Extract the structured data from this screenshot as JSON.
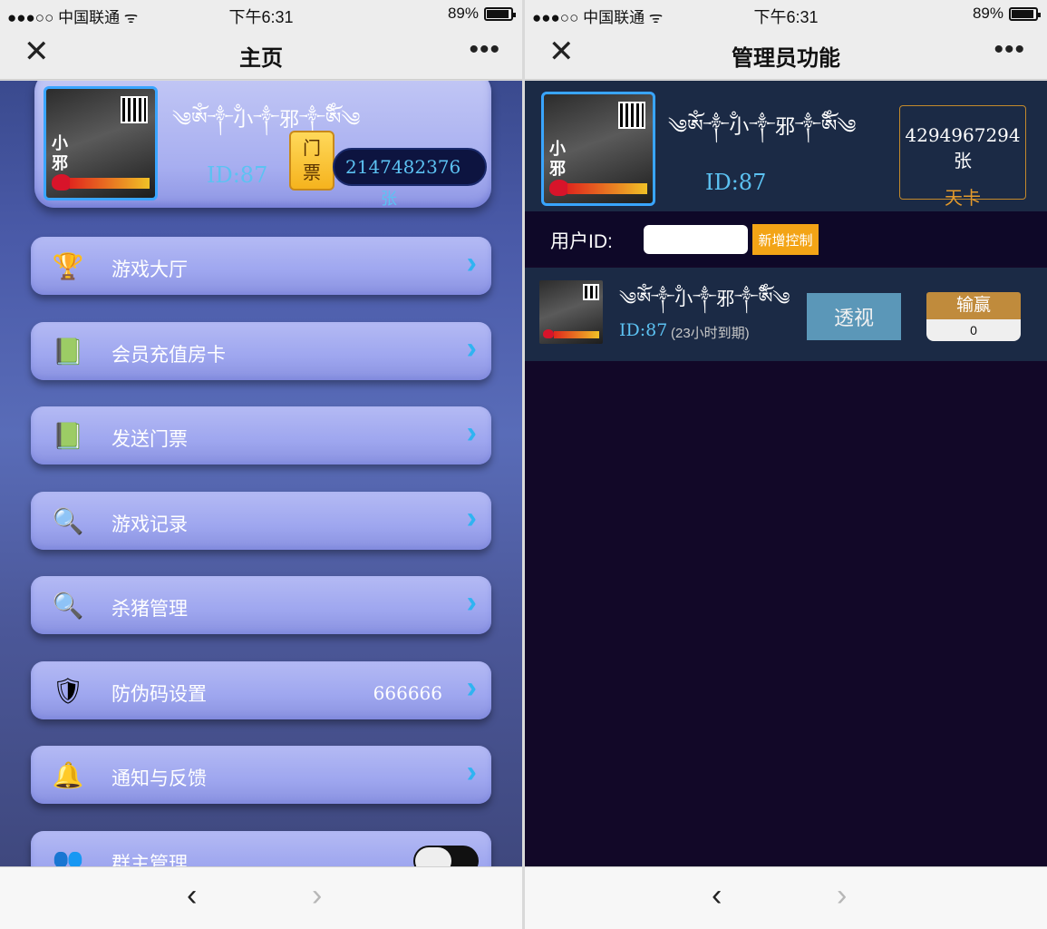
{
  "status_bar": {
    "carrier": "●●●○○ 中国联通 ᯤ",
    "time": "下午6:31",
    "battery": "89%"
  },
  "left_screen": {
    "nav": {
      "close_icon": "✕",
      "title": "主页",
      "more_icon": "•••"
    },
    "profile": {
      "avatar_text": "小\n邪",
      "nickname": "༄ༀ༒ྃ小༒邪༒ྃༀ༄",
      "id": "ID:87",
      "ticket_badge": "门\n票",
      "ticket_count": "2147482376",
      "ticket_unit": "张"
    },
    "menu": [
      {
        "icon": "trophy-icon",
        "glyph": "🏆",
        "label": "游戏大厅",
        "value": "",
        "control": "arrow"
      },
      {
        "icon": "book-icon",
        "glyph": "📗",
        "label": "会员充值房卡",
        "value": "",
        "control": "arrow"
      },
      {
        "icon": "book-icon",
        "glyph": "📗",
        "label": "发送门票",
        "value": "",
        "control": "arrow"
      },
      {
        "icon": "magnifier-icon",
        "glyph": "🔍",
        "label": "游戏记录",
        "value": "",
        "control": "arrow"
      },
      {
        "icon": "magnifier-icon",
        "glyph": "🔍",
        "label": "杀猪管理",
        "value": "",
        "control": "arrow"
      },
      {
        "icon": "shield-icon",
        "glyph": "🛡",
        "label": "防伪码设置",
        "value": "666666",
        "control": "arrow"
      },
      {
        "icon": "bell-icon",
        "glyph": "🔔",
        "label": "通知与反馈",
        "value": "",
        "control": "arrow"
      },
      {
        "icon": "group-icon",
        "glyph": "👥",
        "label": "群主管理",
        "value": "",
        "control": "toggle"
      }
    ],
    "arrow_glyph": "›",
    "bottom": {
      "back": "‹",
      "forward": "›"
    }
  },
  "right_screen": {
    "nav": {
      "close_icon": "✕",
      "title": "管理员功能",
      "more_icon": "•••"
    },
    "profile": {
      "nickname": "༄ༀ༒ྃ小༒邪༒ྃༀ༄",
      "id": "ID:87",
      "card_count": "4294967294张",
      "card_type": "天卡"
    },
    "user_id_form": {
      "label": "用户ID:",
      "input_value": "",
      "button": "新增控制"
    },
    "controlled_user": {
      "nickname": "༄ༀ༒ྃ小༒邪༒ྃༀ༄",
      "id": "ID:87",
      "expire": "(23小时到期)",
      "see_button": "透视",
      "win_label": "输赢",
      "win_value": "0"
    },
    "bottom": {
      "back": "‹",
      "forward": "›"
    }
  }
}
